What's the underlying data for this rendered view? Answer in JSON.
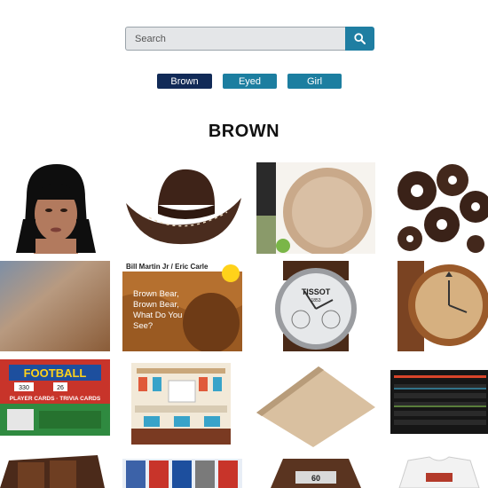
{
  "search": {
    "placeholder": "Search"
  },
  "tags": [
    {
      "label": "Brown",
      "active": true
    },
    {
      "label": "Eyed",
      "active": false
    },
    {
      "label": "Girl",
      "active": false
    }
  ],
  "page_title": "BROWN",
  "products": [
    {
      "name": "black-hair-wig-mannequin"
    },
    {
      "name": "brown-cowboy-hat"
    },
    {
      "name": "brown-paper-plates"
    },
    {
      "name": "brown-hair-bun-donuts"
    },
    {
      "name": "brown-surface-texture"
    },
    {
      "name": "brown-bear-book",
      "title_text": "Brown Bear, Brown Bear, What Do You See?",
      "author_text": "Bill Martin Jr / Eric Carle"
    },
    {
      "name": "tissot-brown-leather-watch",
      "brand_text": "TISSOT",
      "year_text": "1853"
    },
    {
      "name": "wooden-watch"
    },
    {
      "name": "football-cards-box",
      "box_text": "FOOTBALL",
      "sub_text": "PLAYER CARDS · TRIVIA CARDS",
      "num_left": "330",
      "num_right": "26"
    },
    {
      "name": "toy-kitchen-playset"
    },
    {
      "name": "brown-kraft-paper-roll"
    },
    {
      "name": "mechanical-keyboard"
    },
    {
      "name": "brown-leather-wallet"
    },
    {
      "name": "football-trading-cards"
    },
    {
      "name": "brown-leather-item",
      "label_text": "60"
    },
    {
      "name": "white-tshirt"
    }
  ],
  "colors": {
    "search_button": "#1f7ea2",
    "tag_active": "#112a57",
    "tag_inactive": "#1c7ea0"
  }
}
